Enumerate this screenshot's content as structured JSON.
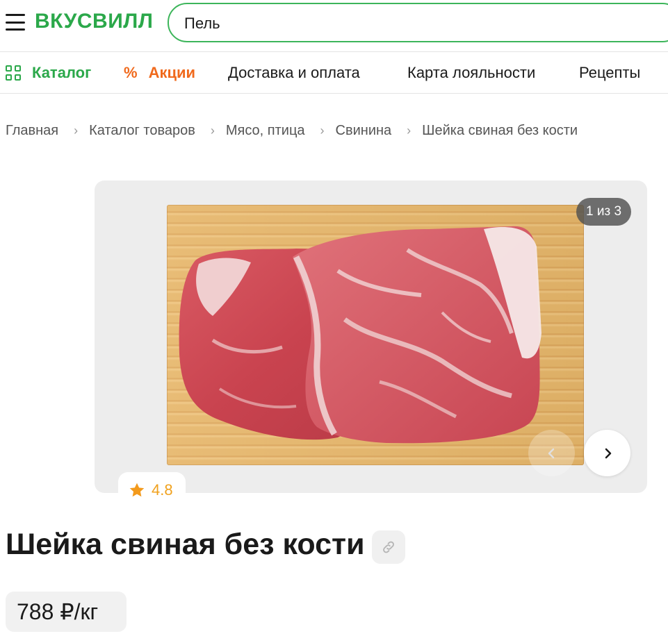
{
  "header": {
    "logo": "ВКУСВИЛЛ",
    "search_value": "Пель",
    "brand_color": "#2ba84a"
  },
  "nav": {
    "catalog": "Каталог",
    "sales": "Акции",
    "delivery": "Доставка и оплата",
    "loyalty": "Карта лояльности",
    "recipes": "Рецепты"
  },
  "breadcrumb": [
    "Главная",
    "Каталог товаров",
    "Мясо, птица",
    "Свинина",
    "Шейка свиная без кости"
  ],
  "gallery": {
    "counter": "1 из 3",
    "current_image": 1,
    "total_images": 3
  },
  "product": {
    "title": "Шейка свиная без кости",
    "rating": "4.8",
    "price": "788 ₽/кг"
  },
  "icons": {
    "menu": "hamburger-icon",
    "catalog": "grid-icon",
    "sales": "percent-icon",
    "rating": "star-icon",
    "next": "chevron-right-icon",
    "prev": "chevron-left-icon",
    "share": "link-icon"
  },
  "colors": {
    "accent_green": "#2ba84a",
    "sales_orange": "#f06a1d",
    "rating_orange": "#f0a11d"
  }
}
